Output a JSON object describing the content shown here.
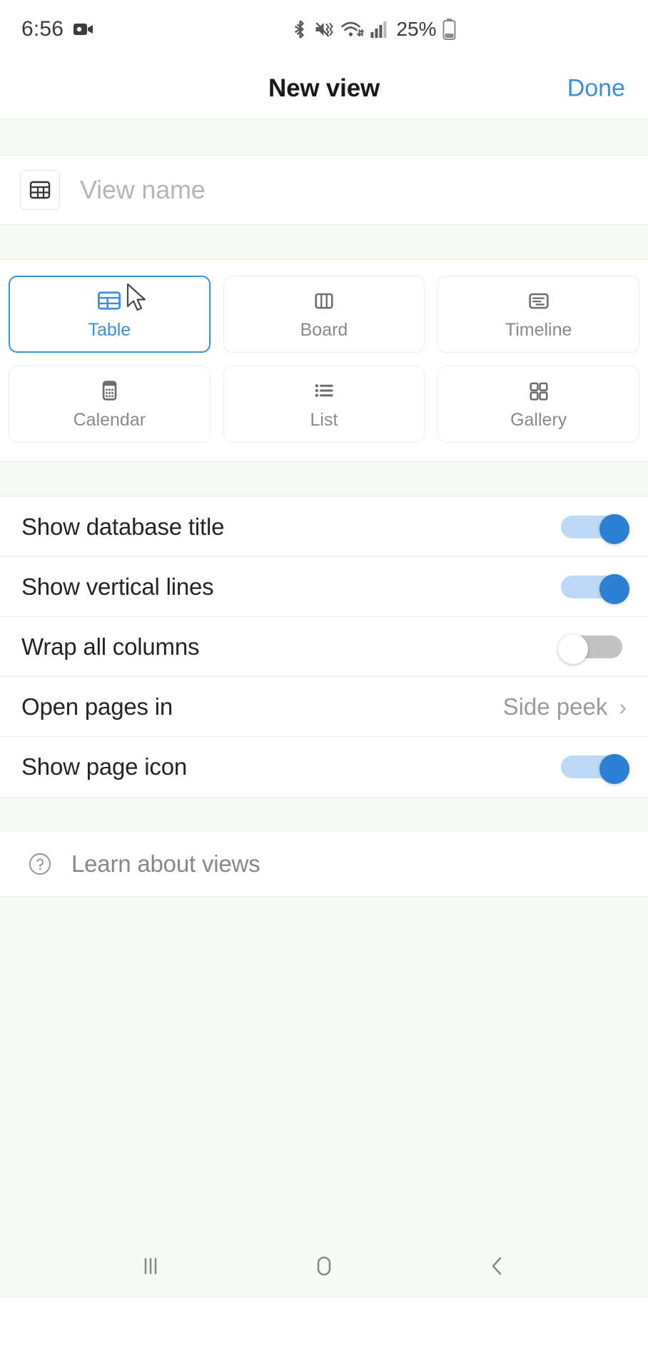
{
  "status_bar": {
    "time": "6:56",
    "battery_percent": "25%",
    "icons": [
      "screen-recorder-icon",
      "bluetooth-icon",
      "mute-vibrate-icon",
      "wifi-icon",
      "cellular-signal-icon",
      "battery-icon"
    ]
  },
  "header": {
    "title": "New view",
    "action_label": "Done"
  },
  "view_name": {
    "placeholder": "View name",
    "value": "",
    "icon": "table-icon"
  },
  "view_types": [
    {
      "label": "Table",
      "icon": "table-icon",
      "selected": true
    },
    {
      "label": "Board",
      "icon": "board-icon",
      "selected": false
    },
    {
      "label": "Timeline",
      "icon": "timeline-icon",
      "selected": false
    },
    {
      "label": "Calendar",
      "icon": "calendar-icon",
      "selected": false
    },
    {
      "label": "List",
      "icon": "list-icon",
      "selected": false
    },
    {
      "label": "Gallery",
      "icon": "gallery-icon",
      "selected": false
    }
  ],
  "settings": [
    {
      "label": "Show database title",
      "type": "toggle",
      "state": "on"
    },
    {
      "label": "Show vertical lines",
      "type": "toggle",
      "state": "on"
    },
    {
      "label": "Wrap all columns",
      "type": "toggle",
      "state": "off"
    },
    {
      "label": "Open pages in",
      "type": "select",
      "value": "Side peek"
    },
    {
      "label": "Show page icon",
      "type": "toggle",
      "state": "on"
    }
  ],
  "learn": {
    "label": "Learn about views",
    "icon": "help-circle-icon"
  },
  "nav_bar": {
    "recents_label": "Recents",
    "home_label": "Home",
    "back_label": "Back"
  },
  "colors": {
    "accent": "#3a8fe0",
    "toggle_on_track": "#bcd9f5",
    "toggle_on_knob": "#2b7fd4",
    "toggle_off_track": "#c2c2c2",
    "band": "#f7f9f5",
    "label_text": "#252525",
    "muted_text": "#9b9b9b"
  }
}
